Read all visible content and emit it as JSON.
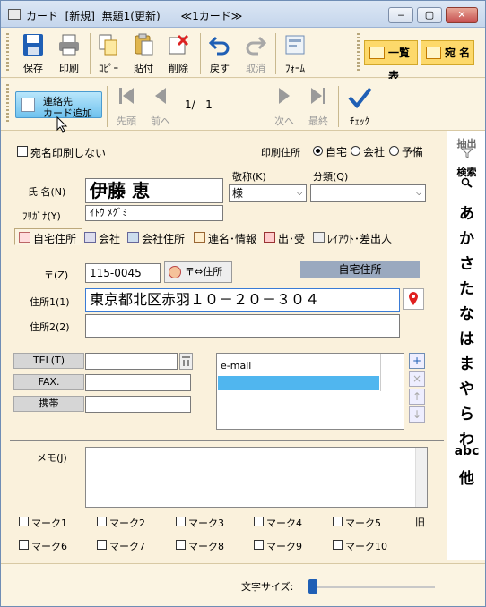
{
  "title": "カード  [新規]  無題1(更新)      ≪1カード≫",
  "window_buttons": [
    "‒",
    "▢",
    "✕"
  ],
  "toolbar": {
    "save": "保存",
    "print": "印刷",
    "copy": "ｺﾋﾟｰ",
    "paste": "貼付",
    "delete": "削除",
    "undo": "戻す",
    "redo": "取消",
    "form": "ﾌｫｰﾑ",
    "list": "一覧表",
    "address": "宛 名"
  },
  "nav": {
    "add_contact_line1": "連絡先",
    "add_contact_line2": "カード追加",
    "first": "先頭",
    "prev": "前へ",
    "next": "次へ",
    "last": "最終",
    "check": "ﾁｪｯｸ",
    "record": "1/   1"
  },
  "form": {
    "no_address_print": "宛名印刷しない",
    "print_address_label": "印刷住所",
    "print_address_options": [
      "自宅",
      "会社",
      "予備"
    ],
    "print_address_selected": "自宅",
    "honorific_label": "敬称(K)",
    "honorific_value": "様",
    "category_label": "分類(Q)",
    "category_value": "",
    "name_label": "氏 名(N)",
    "name_value": "伊藤  恵",
    "furigana_label": "ﾌﾘｶﾞﾅ(Y)",
    "furigana_value": "ｲﾄｳ ﾒｸﾞﾐ"
  },
  "tabs": [
    {
      "label": "自宅住所",
      "active": true
    },
    {
      "label": "会社",
      "active": false
    },
    {
      "label": "会社住所",
      "active": false
    },
    {
      "label": "連名･情報",
      "active": false
    },
    {
      "label": "出･受",
      "active": false
    },
    {
      "label": "ﾚｲｱｳﾄ･差出人",
      "active": false
    }
  ],
  "address": {
    "zip_label": "〒(Z)",
    "zip_value": "115-0045",
    "zip_to_address": "〒⇔住所",
    "section_header": "自宅住所",
    "address1_label": "住所1(1)",
    "address1_value": "東京都北区赤羽１０－２０－３０４",
    "address2_label": "住所2(2)",
    "address2_value": ""
  },
  "phones": [
    {
      "label": "TEL(T)",
      "value": ""
    },
    {
      "label": "FAX.",
      "value": ""
    },
    {
      "label": "携帯",
      "value": ""
    }
  ],
  "email_list": [
    "e-mail"
  ],
  "memo_label": "メモ(J)",
  "marks": [
    "マーク1",
    "マーク2",
    "マーク3",
    "マーク4",
    "マーク5",
    "マーク6",
    "マーク7",
    "マーク8",
    "マーク9",
    "マーク10"
  ],
  "marks_extra": "旧",
  "footer": {
    "font_size_label": "文字サイズ:"
  },
  "sidebar": {
    "extract": "抽出",
    "search": "検索",
    "kana": [
      "あ",
      "か",
      "さ",
      "た",
      "な",
      "は",
      "ま",
      "や",
      "ら",
      "わ",
      "abc",
      "他"
    ]
  },
  "colors": {
    "accent_blue": "#6fc2ee",
    "window_bg": "#faf1dc",
    "selected_row": "#50b6ef",
    "header_grey": "#9aa9bf"
  }
}
